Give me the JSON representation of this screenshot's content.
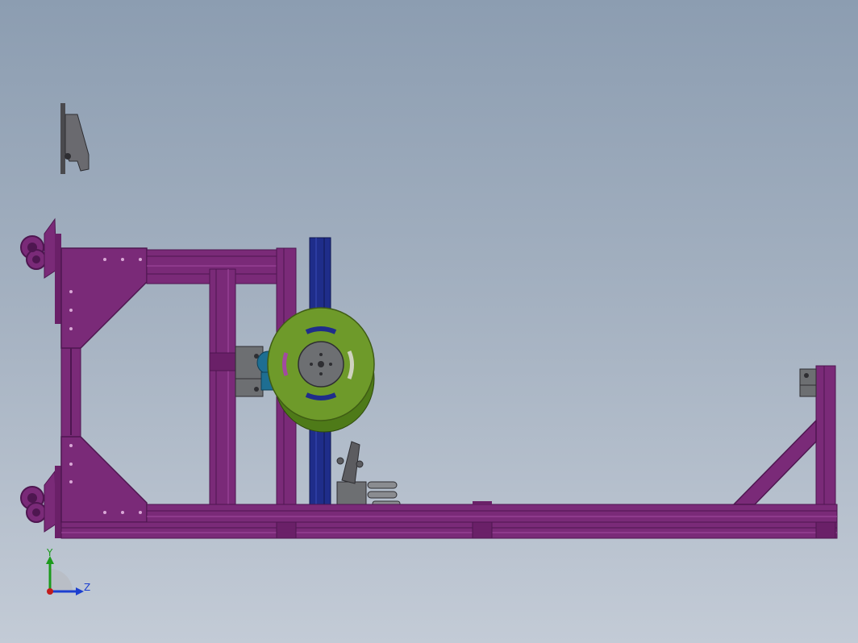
{
  "viewport": {
    "background_top": "#8c9db1",
    "background_bottom": "#c3cbd6"
  },
  "colors": {
    "frame": "#7a2a78",
    "frame_dark": "#4e1650",
    "frame_light": "#a24aa0",
    "column": "#1f2d8a",
    "disc": "#6e9a2a",
    "disc_dark": "#3f5c14",
    "hub": "#6d6f72",
    "part_gray": "#5c5c60",
    "teal": "#1e6e92"
  },
  "triad": {
    "y_label": "Y",
    "z_label": "Z",
    "y_color": "#1c9a1c",
    "z_color": "#1c3fd0",
    "origin_color": "#c21c1c"
  }
}
